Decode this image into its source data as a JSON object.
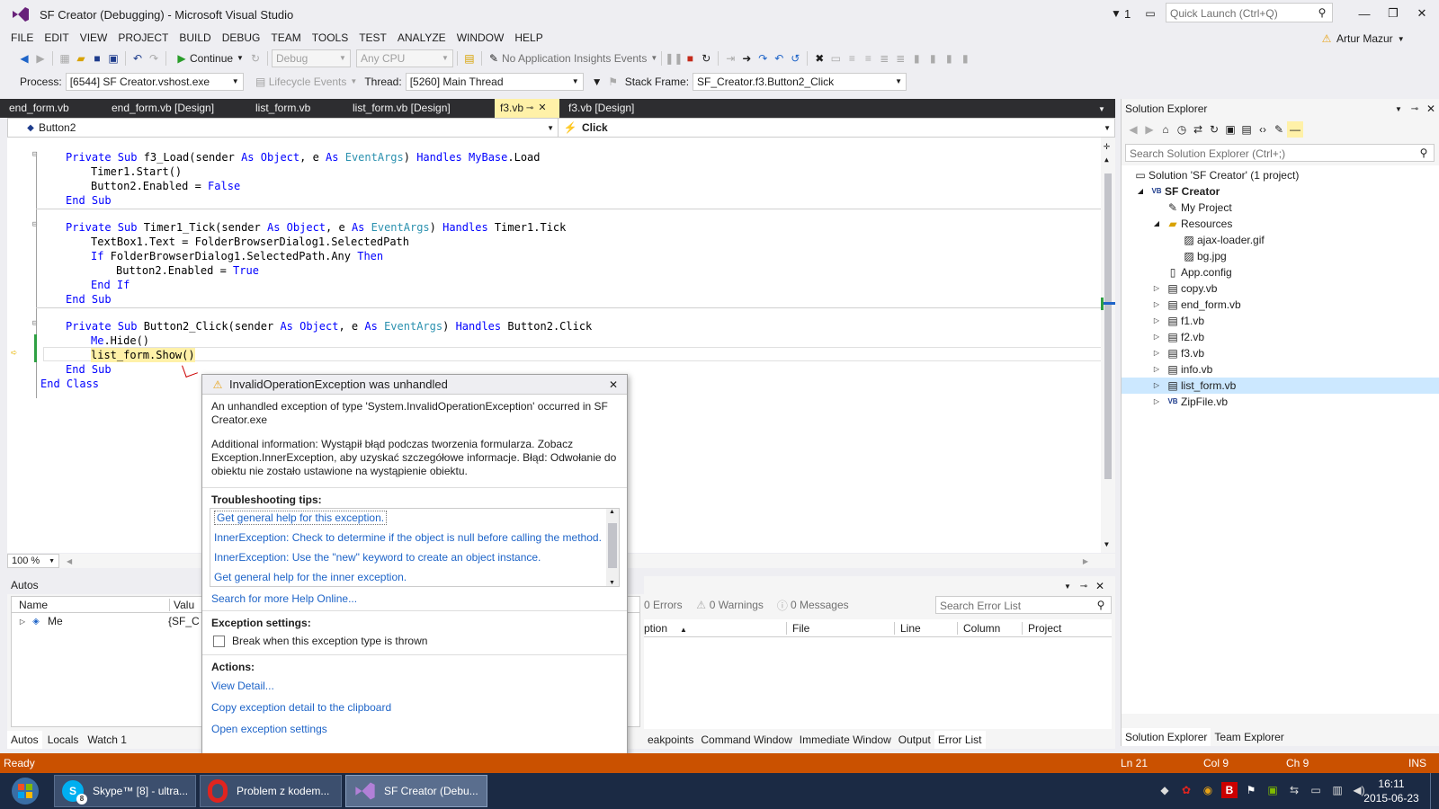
{
  "window": {
    "title": "SF Creator (Debugging) - Microsoft Visual Studio",
    "notif_count": "1",
    "quick_launch_placeholder": "Quick Launch (Ctrl+Q)",
    "user": "Artur Mazur"
  },
  "menu": [
    "FILE",
    "EDIT",
    "VIEW",
    "PROJECT",
    "BUILD",
    "DEBUG",
    "TEAM",
    "TOOLS",
    "TEST",
    "ANALYZE",
    "WINDOW",
    "HELP"
  ],
  "toolbar": {
    "continue": "Continue",
    "config": "Debug",
    "platform": "Any CPU",
    "insights": "No Application Insights Events"
  },
  "debugbar": {
    "process_label": "Process:",
    "process": "[6544] SF Creator.vshost.exe",
    "lifecycle": "Lifecycle Events",
    "thread_label": "Thread:",
    "thread": "[5260] Main Thread",
    "stack_label": "Stack Frame:",
    "stack": "SF_Creator.f3.Button2_Click"
  },
  "tabs": [
    "end_form.vb",
    "end_form.vb [Design]",
    "list_form.vb",
    "list_form.vb [Design]",
    "f3.vb",
    "f3.vb [Design]"
  ],
  "navbar": {
    "left": "Button2",
    "right": "Click"
  },
  "code": {
    "l1": [
      "Private Sub",
      " f3_Load(sender ",
      "As",
      " ",
      "Object",
      ", e ",
      "As",
      " ",
      "EventArgs",
      ") ",
      "Handles",
      " ",
      "MyBase",
      ".Load"
    ],
    "l2": "Timer1.Start()",
    "l3a": "Button2.Enabled = ",
    "l3b": "False",
    "l4": "End Sub",
    "l5": [
      "Private Sub",
      " Timer1_Tick(sender ",
      "As",
      " ",
      "Object",
      ", e ",
      "As",
      " ",
      "EventArgs",
      ") ",
      "Handles",
      " Timer1.Tick"
    ],
    "l6": "TextBox1.Text = FolderBrowserDialog1.SelectedPath",
    "l7a": "If",
    " l7b": "",
    "l7c": " FolderBrowserDialog1.SelectedPath.Any ",
    "l7d": "Then",
    "l8a": "Button2.Enabled = ",
    "l8b": "True",
    "l9": "End If",
    "l10": "End Sub",
    "l11": [
      "Private Sub",
      " Button2_Click(sender ",
      "As",
      " ",
      "Object",
      ", e ",
      "As",
      " ",
      "EventArgs",
      ") ",
      "Handles",
      " Button2.Click"
    ],
    "l12a": "Me",
    ".l12b": "",
    "l12c": ".Hide()",
    "l13": "list_form.Show()",
    "l14": "End Sub",
    "l15": "End Class"
  },
  "zoom": "100 %",
  "exception": {
    "title": "InvalidOperationException was unhandled",
    "msg": "An unhandled exception of type 'System.InvalidOperationException' occurred in SF Creator.exe",
    "info": "Additional information: Wystąpił błąd podczas tworzenia formularza. Zobacz Exception.InnerException, aby uzyskać szczegółowe informacje. Błąd: Odwołanie do obiektu nie zostało ustawione na wystąpienie obiektu.",
    "tips_header": "Troubleshooting tips:",
    "tips": [
      "Get general help for this exception.",
      "InnerException: Check to determine if the object is null before calling the method.",
      "InnerException: Use the \"new\" keyword to create an object instance.",
      "Get general help for the inner exception."
    ],
    "search_online": "Search for more Help Online...",
    "settings_header": "Exception settings:",
    "break_label": "Break when this exception type is thrown",
    "actions_header": "Actions:",
    "actions": [
      "View Detail...",
      "Copy exception detail to the clipboard",
      "Open exception settings"
    ]
  },
  "autos": {
    "title": "Autos",
    "cols": [
      "Name",
      "Valu"
    ],
    "row_name": "Me",
    "row_val": "{SF_C",
    "tabs": [
      "Autos",
      "Locals",
      "Watch 1"
    ]
  },
  "errorlist": {
    "errors": "0 Errors",
    "warnings": "0 Warnings",
    "messages": "0 Messages",
    "search": "Search Error List",
    "cols": [
      "ption",
      "File",
      "Line",
      "Column",
      "Project"
    ],
    "tabs": [
      "eakpoints",
      "Command Window",
      "Immediate Window",
      "Output",
      "Error List"
    ]
  },
  "solution": {
    "title": "Solution Explorer",
    "search": "Search Solution Explorer (Ctrl+;)",
    "items": [
      "Solution 'SF Creator' (1 project)",
      "SF Creator",
      "My Project",
      "Resources",
      "ajax-loader.gif",
      "bg.jpg",
      "App.config",
      "copy.vb",
      "end_form.vb",
      "f1.vb",
      "f2.vb",
      "f3.vb",
      "info.vb",
      "list_form.vb",
      "ZipFile.vb"
    ],
    "tabs": [
      "Solution Explorer",
      "Team Explorer"
    ]
  },
  "status": {
    "ready": "Ready",
    "ln": "Ln 21",
    "col": "Col 9",
    "ch": "Ch 9",
    "ins": "INS"
  },
  "taskbar": {
    "items": [
      "Skype™ [8] - ultra...",
      "Problem z kodem...",
      "SF Creator (Debu..."
    ],
    "time": "16:11",
    "date": "2015-06-23",
    "skype_badge": "8"
  },
  "colors": {
    "accent": "#ca5100",
    "tab_active": "#fff1a8",
    "link": "#1e64c8"
  }
}
